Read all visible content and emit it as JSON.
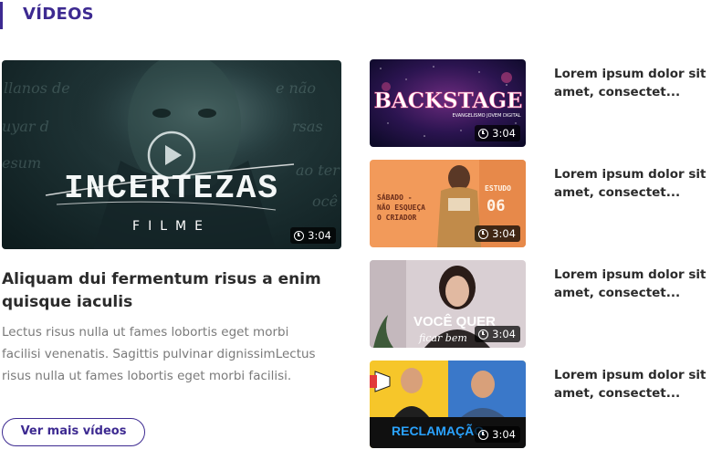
{
  "section": {
    "title": "VÍDEOS"
  },
  "featured": {
    "thumbnail_title": "INCERTEZAS",
    "thumbnail_subtitle": "FILME",
    "duration": "3:04",
    "title": "Aliquam dui fermentum risus a enim quisque iaculis",
    "description": "Lectus risus nulla ut fames lobortis eget morbi facilisi venenatis. Sagittis pulvinar dignissimLectus risus nulla ut fames lobortis eget morbi facilisi.",
    "background_words": [
      "llanos de",
      "e não",
      "uyar d",
      "rsas",
      "esum",
      "ao ter",
      "ocê"
    ]
  },
  "more_button": {
    "label": "Ver mais vídeos"
  },
  "side_videos": [
    {
      "thumb_title": "BACKSTAGE",
      "thumb_subtitle": "EVANGELISMO JOVEM DIGITAL",
      "duration": "3:04",
      "title": "Lorem ipsum dolor sit amet, consectet..."
    },
    {
      "thumb_title": "SÁBADO -",
      "thumb_line2": "NÃO ESQUEÇA",
      "thumb_line3": "O CRIADOR",
      "thumb_right_label": "ESTUDO",
      "thumb_right_number": "06",
      "duration": "3:04",
      "title": "Lorem ipsum dolor sit amet, consectet..."
    },
    {
      "thumb_title": "VOCÊ QUER",
      "thumb_subtitle": "ficar bem",
      "duration": "3:04",
      "title": "Lorem ipsum dolor sit amet, consectet..."
    },
    {
      "thumb_title": "RECLAMAÇÃO",
      "duration": "3:04",
      "title": "Lorem ipsum dolor sit amet, consectet..."
    }
  ],
  "colors": {
    "accent": "#3d2a91",
    "text_dark": "#2b2b2b",
    "text_muted": "#7a7a7a",
    "thumb_orange": "#f29a5a",
    "thumb_yellow": "#f6c62a"
  }
}
